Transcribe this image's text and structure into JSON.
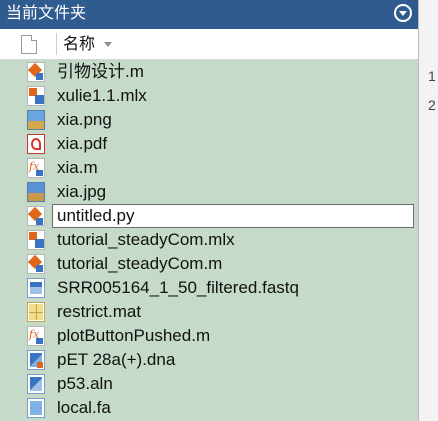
{
  "panel": {
    "title": "当前文件夹",
    "column_header": "名称"
  },
  "files": [
    {
      "name": "引物设计.m",
      "icon": "matlab-script-icon"
    },
    {
      "name": "xulie1.1.mlx",
      "icon": "live-script-icon"
    },
    {
      "name": "xia.png",
      "icon": "png-image-icon"
    },
    {
      "name": "xia.pdf",
      "icon": "pdf-file-icon"
    },
    {
      "name": "xia.m",
      "icon": "matlab-function-icon"
    },
    {
      "name": "xia.jpg",
      "icon": "jpg-image-icon"
    },
    {
      "name": "untitled.py",
      "icon": "python-file-icon",
      "editing": true
    },
    {
      "name": "tutorial_steadyCom.mlx",
      "icon": "live-script-icon"
    },
    {
      "name": "tutorial_steadyCom.m",
      "icon": "matlab-script-icon"
    },
    {
      "name": "SRR005164_1_50_filtered.fastq",
      "icon": "sequence-data-icon"
    },
    {
      "name": "restrict.mat",
      "icon": "mat-file-icon"
    },
    {
      "name": "plotButtonPushed.m",
      "icon": "matlab-function-icon"
    },
    {
      "name": "pET 28a(+).dna",
      "icon": "dna-file-icon"
    },
    {
      "name": "p53.aln",
      "icon": "alignment-file-icon"
    },
    {
      "name": "local.fa",
      "icon": "fasta-file-icon"
    }
  ],
  "editor": {
    "line_numbers": [
      "1",
      "2"
    ]
  }
}
